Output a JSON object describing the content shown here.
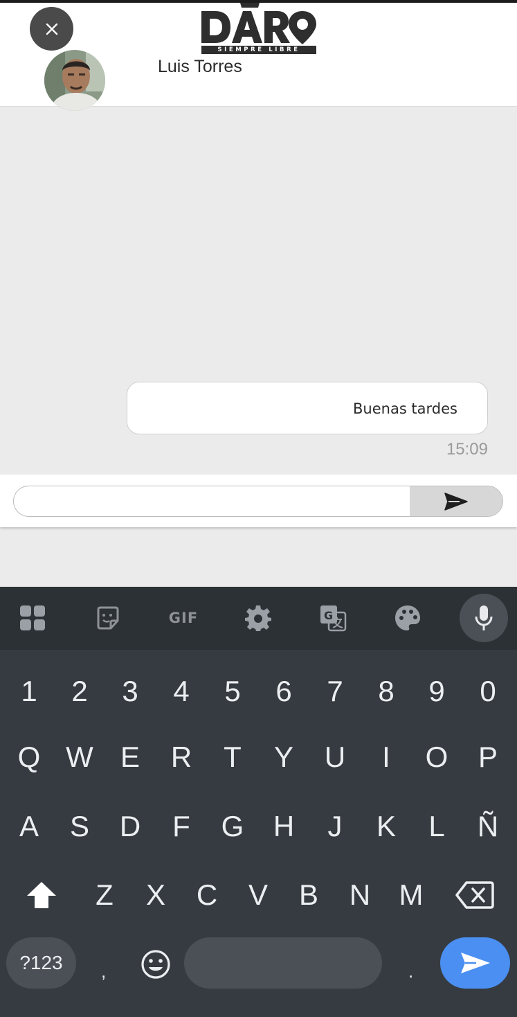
{
  "header": {
    "close_icon": "close-icon",
    "logo_text": "DARO",
    "logo_tagline": "SIEMPRE LIBRE"
  },
  "contact": {
    "name": "Luis Torres",
    "avatar_icon": "user-avatar"
  },
  "messages": [
    {
      "text": "Buenas tardes",
      "time": "15:09"
    }
  ],
  "compose": {
    "value": "",
    "placeholder": "",
    "send_icon": "send-icon"
  },
  "keyboard": {
    "toolbar": [
      "apps-grid-icon",
      "sticker-icon",
      "GIF",
      "gear-icon",
      "translate-icon",
      "palette-icon",
      "microphone-icon"
    ],
    "rows": {
      "numbers": [
        "1",
        "2",
        "3",
        "4",
        "5",
        "6",
        "7",
        "8",
        "9",
        "0"
      ],
      "row1": [
        "Q",
        "W",
        "E",
        "R",
        "T",
        "Y",
        "U",
        "I",
        "O",
        "P"
      ],
      "row2": [
        "A",
        "S",
        "D",
        "F",
        "G",
        "H",
        "J",
        "K",
        "L",
        "Ñ"
      ],
      "row3": [
        "Z",
        "X",
        "C",
        "V",
        "B",
        "N",
        "M"
      ]
    },
    "symbols_label": "?123",
    "comma": ",",
    "period": ".",
    "enter_icon": "send-arrow-icon",
    "accent_color": "#4a8ff1"
  }
}
